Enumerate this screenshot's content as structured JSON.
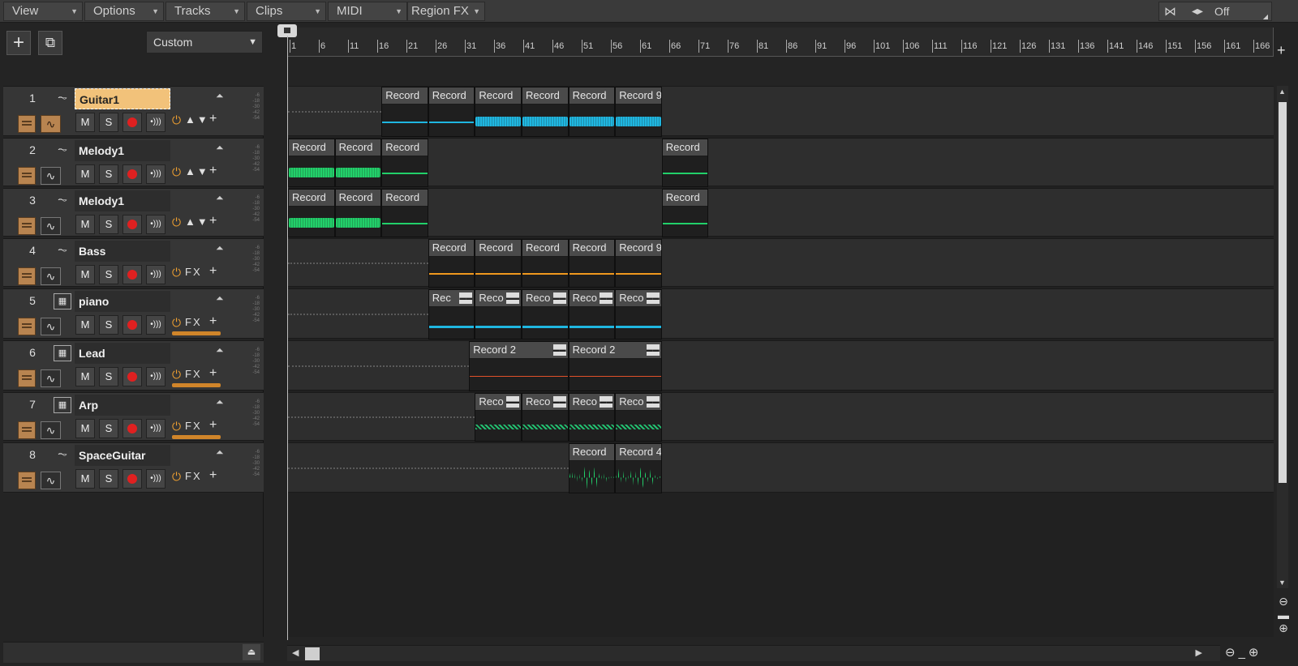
{
  "menubar": {
    "items": [
      {
        "label": "View"
      },
      {
        "label": "Options"
      },
      {
        "label": "Tracks"
      },
      {
        "label": "Clips"
      },
      {
        "label": "MIDI"
      },
      {
        "label": "Region FX"
      }
    ],
    "snap_value": "Off"
  },
  "track_view": {
    "preset": "Custom"
  },
  "ruler": {
    "ticks": [
      "1",
      "6",
      "11",
      "16",
      "21",
      "26",
      "31",
      "36",
      "41",
      "46",
      "51",
      "56",
      "61",
      "66",
      "71",
      "76",
      "81",
      "86",
      "91",
      "96",
      "101",
      "106",
      "111",
      "116",
      "121",
      "126",
      "131",
      "136",
      "141",
      "146",
      "151",
      "156",
      "161",
      "166"
    ]
  },
  "tracks": [
    {
      "num": "1",
      "name": "Guitar1",
      "type": "audio",
      "selected": true,
      "tail": "▲▼",
      "clips": [
        {
          "label": "Record",
          "start": 16,
          "end": 24,
          "color": "#1fb6e0",
          "style": "thin"
        },
        {
          "label": "Record",
          "start": 24,
          "end": 32,
          "color": "#1fb6e0",
          "style": "thin"
        },
        {
          "label": "Record",
          "start": 32,
          "end": 40,
          "color": "#1fb6e0",
          "style": "thick"
        },
        {
          "label": "Record",
          "start": 40,
          "end": 48,
          "color": "#1fb6e0",
          "style": "thick"
        },
        {
          "label": "Record",
          "start": 48,
          "end": 56,
          "color": "#1fb6e0",
          "style": "thick"
        },
        {
          "label": "Record 9",
          "start": 56,
          "end": 64,
          "color": "#1fb6e0",
          "style": "thick"
        }
      ]
    },
    {
      "num": "2",
      "name": "Melody1",
      "type": "audio",
      "selected": false,
      "tail": "▲▼",
      "clips": [
        {
          "label": "Record",
          "start": 0,
          "end": 8,
          "color": "#22d06a",
          "style": "thick"
        },
        {
          "label": "Record",
          "start": 8,
          "end": 16,
          "color": "#22d06a",
          "style": "thick"
        },
        {
          "label": "Record",
          "start": 16,
          "end": 24,
          "color": "#22d06a",
          "style": "thin"
        },
        {
          "label": "Record",
          "start": 64,
          "end": 72,
          "color": "#22d06a",
          "style": "thin"
        }
      ]
    },
    {
      "num": "3",
      "name": "Melody1",
      "type": "audio",
      "selected": false,
      "tail": "▲▼",
      "clips": [
        {
          "label": "Record",
          "start": 0,
          "end": 8,
          "color": "#22d06a",
          "style": "thick"
        },
        {
          "label": "Record",
          "start": 8,
          "end": 16,
          "color": "#22d06a",
          "style": "thick"
        },
        {
          "label": "Record",
          "start": 16,
          "end": 24,
          "color": "#22d06a",
          "style": "thin"
        },
        {
          "label": "Record",
          "start": 64,
          "end": 72,
          "color": "#22d06a",
          "style": "thin"
        }
      ]
    },
    {
      "num": "4",
      "name": "Bass",
      "type": "audio",
      "selected": false,
      "tail": "FX",
      "clips": [
        {
          "label": "Record",
          "start": 24,
          "end": 32,
          "color": "#f0981e",
          "style": "thin"
        },
        {
          "label": "Record",
          "start": 32,
          "end": 40,
          "color": "#f0981e",
          "style": "thin"
        },
        {
          "label": "Record",
          "start": 40,
          "end": 48,
          "color": "#f0981e",
          "style": "thin"
        },
        {
          "label": "Record",
          "start": 48,
          "end": 56,
          "color": "#f0981e",
          "style": "thin"
        },
        {
          "label": "Record 9",
          "start": 56,
          "end": 64,
          "color": "#f0981e",
          "style": "thin"
        }
      ]
    },
    {
      "num": "5",
      "name": "piano",
      "type": "instrument",
      "selected": false,
      "tail": "FX",
      "bar": true,
      "clips": [
        {
          "label": "Rec",
          "start": 24,
          "end": 32,
          "color": "#1fb6e0",
          "style": "midi",
          "group": true
        },
        {
          "label": "Reco",
          "start": 32,
          "end": 40,
          "color": "#1fb6e0",
          "style": "midi",
          "group": true
        },
        {
          "label": "Reco",
          "start": 40,
          "end": 48,
          "color": "#1fb6e0",
          "style": "midi",
          "group": true
        },
        {
          "label": "Reco",
          "start": 48,
          "end": 56,
          "color": "#1fb6e0",
          "style": "midi",
          "group": true
        },
        {
          "label": "Reco",
          "start": 56,
          "end": 64,
          "color": "#1fb6e0",
          "style": "midi",
          "group": true
        }
      ]
    },
    {
      "num": "6",
      "name": "Lead",
      "type": "instrument",
      "selected": false,
      "tail": "FX",
      "bar": true,
      "clips": [
        {
          "label": "Record 2",
          "start": 31,
          "end": 48,
          "color": "#e0502a",
          "style": "line",
          "group": true
        },
        {
          "label": "Record 2",
          "start": 48,
          "end": 64,
          "color": "#e0502a",
          "style": "line",
          "group": true
        }
      ]
    },
    {
      "num": "7",
      "name": "Arp",
      "type": "instrument",
      "selected": false,
      "tail": "FX",
      "bar": true,
      "clips": [
        {
          "label": "Reco",
          "start": 32,
          "end": 40,
          "color": "#22c070",
          "style": "dash",
          "group": true
        },
        {
          "label": "Reco",
          "start": 40,
          "end": 48,
          "color": "#22c070",
          "style": "dash",
          "group": true
        },
        {
          "label": "Reco",
          "start": 48,
          "end": 56,
          "color": "#22c070",
          "style": "dash",
          "group": true
        },
        {
          "label": "Reco",
          "start": 56,
          "end": 64,
          "color": "#22c070",
          "style": "dash",
          "group": true
        }
      ]
    },
    {
      "num": "8",
      "name": "SpaceGuitar",
      "type": "audio",
      "selected": false,
      "tail": "FX",
      "clips": [
        {
          "label": "Record",
          "start": 48,
          "end": 56,
          "color": "#22d06a",
          "style": "spiky"
        },
        {
          "label": "Record 4",
          "start": 56,
          "end": 64,
          "color": "#22d06a",
          "style": "spiky"
        }
      ]
    }
  ],
  "buttons": {
    "mute": "M",
    "solo": "S"
  }
}
